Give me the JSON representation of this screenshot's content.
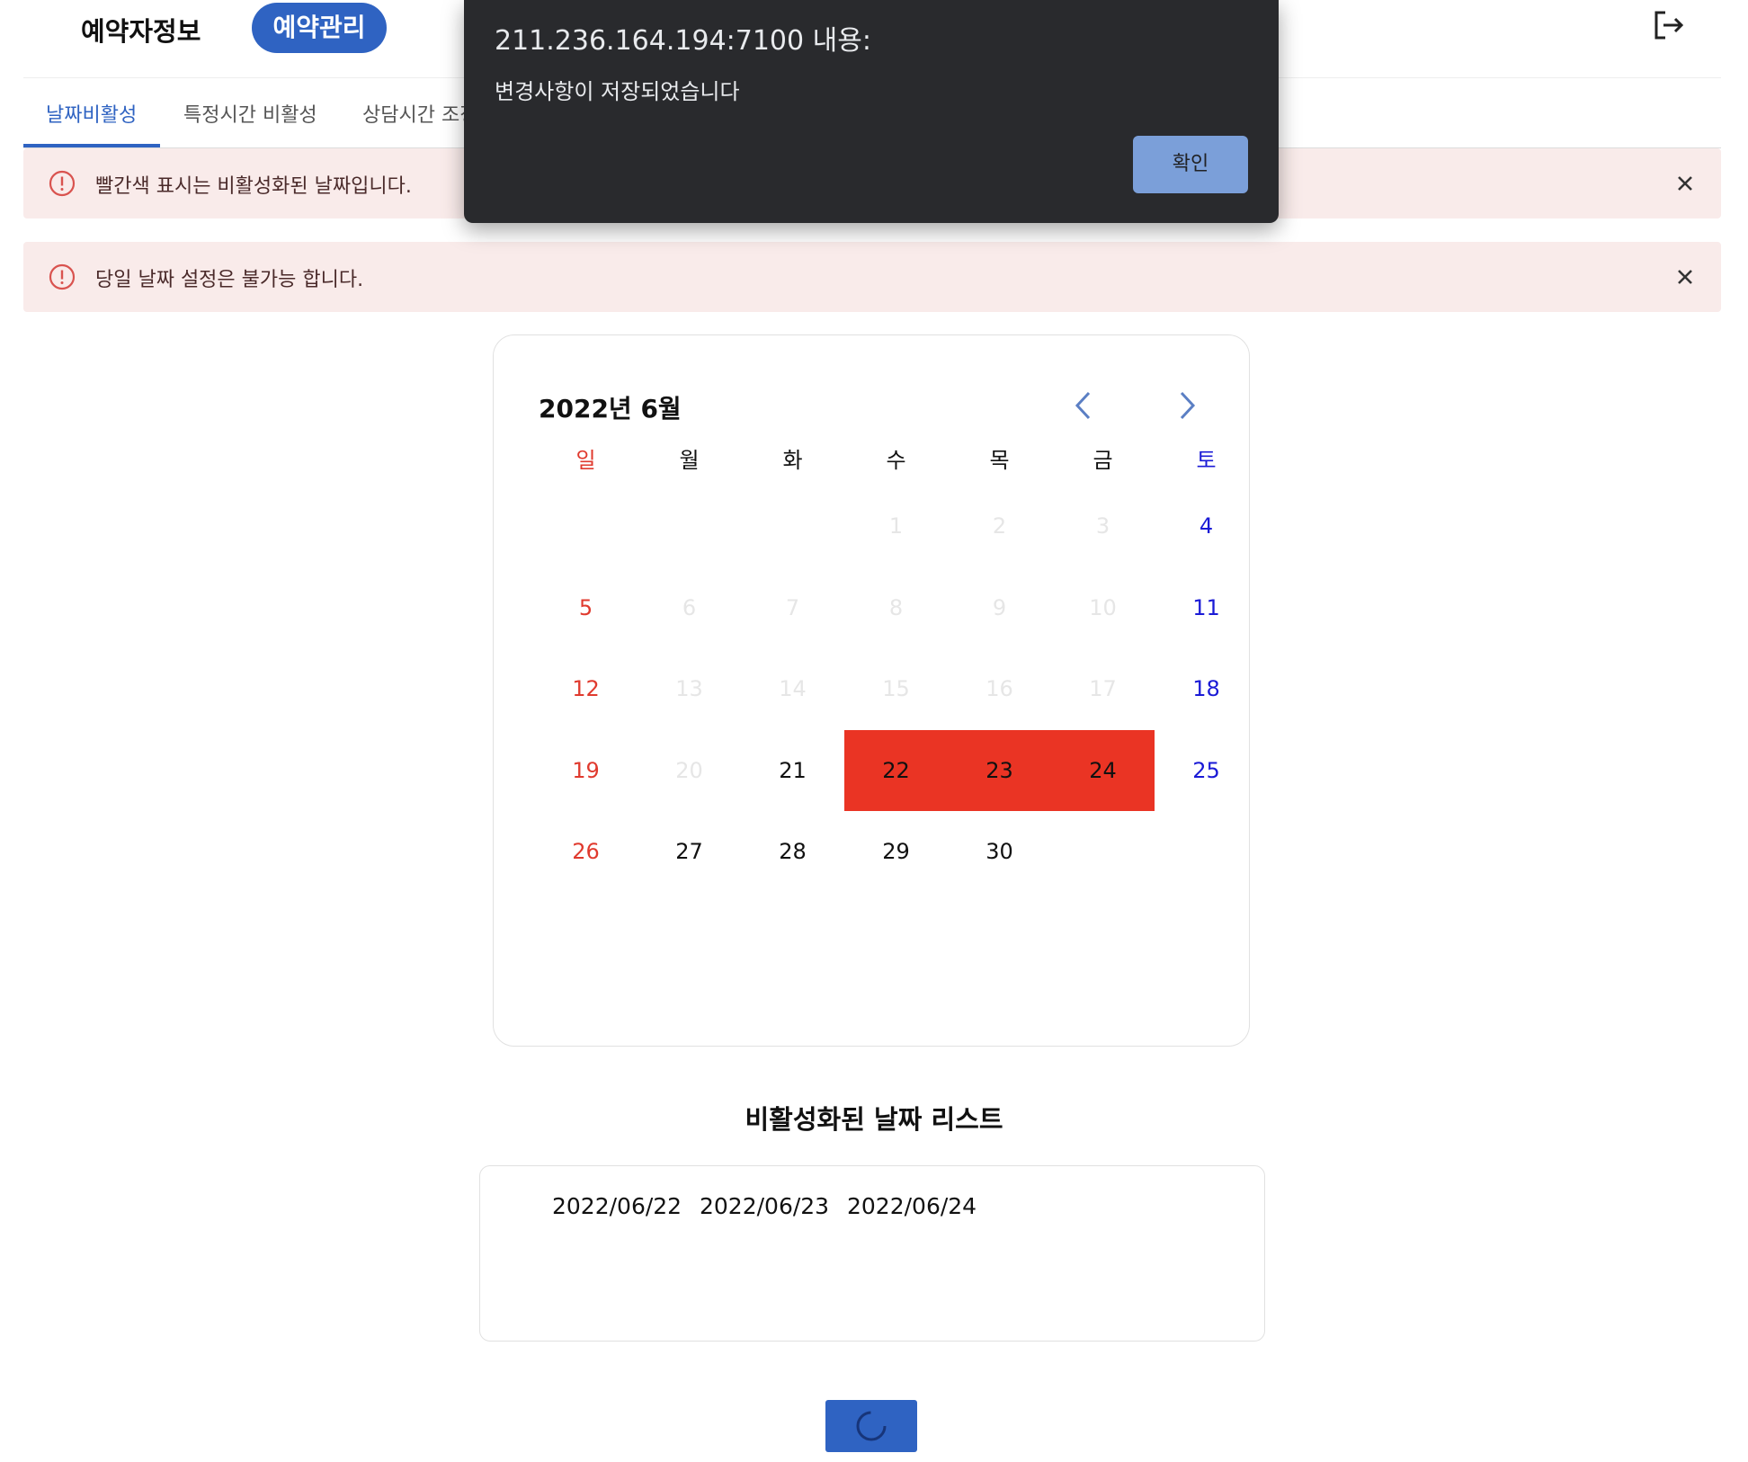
{
  "header": {
    "brand": "예약자정보",
    "nav_active": "예약관리",
    "logout_icon": "logout-icon"
  },
  "tabs": [
    {
      "label": "날짜비활성",
      "active": true
    },
    {
      "label": "특정시간 비활성",
      "active": false
    },
    {
      "label": "상담시간 조정",
      "active": false
    }
  ],
  "alerts": [
    {
      "text": "빨간색 표시는 비활성화된 날짜입니다."
    },
    {
      "text": "당일 날짜 설정은 불가능 합니다."
    }
  ],
  "calendar": {
    "title": "2022년 6월",
    "weekdays": [
      "일",
      "월",
      "화",
      "수",
      "목",
      "금",
      "토"
    ],
    "weeks": [
      [
        "",
        "",
        "",
        "1",
        "2",
        "3",
        "4"
      ],
      [
        "5",
        "6",
        "7",
        "8",
        "9",
        "10",
        "11"
      ],
      [
        "12",
        "13",
        "14",
        "15",
        "16",
        "17",
        "18"
      ],
      [
        "19",
        "20",
        "21",
        "22",
        "23",
        "24",
        "25"
      ],
      [
        "26",
        "27",
        "28",
        "29",
        "30",
        "",
        ""
      ]
    ],
    "past_dates": [
      "1",
      "2",
      "3",
      "6",
      "7",
      "8",
      "9",
      "10",
      "13",
      "14",
      "15",
      "16",
      "17",
      "20"
    ],
    "disabled_dates": [
      "22",
      "23",
      "24"
    ],
    "colors": {
      "sunday": "#e03a2e",
      "saturday": "#1a1ad6",
      "disabled_bg": "#ea3424",
      "accent": "#2f63c2"
    }
  },
  "disabled_list": {
    "title": "비활성화된 날짜 리스트",
    "dates": [
      "2022/06/22",
      "2022/06/23",
      "2022/06/24"
    ]
  },
  "save_button": {
    "state": "loading",
    "icon": "spinner-icon"
  },
  "dialog": {
    "title": "211.236.164.194:7100 내용:",
    "message": "변경사항이 저장되었습니다",
    "ok_label": "확인"
  }
}
